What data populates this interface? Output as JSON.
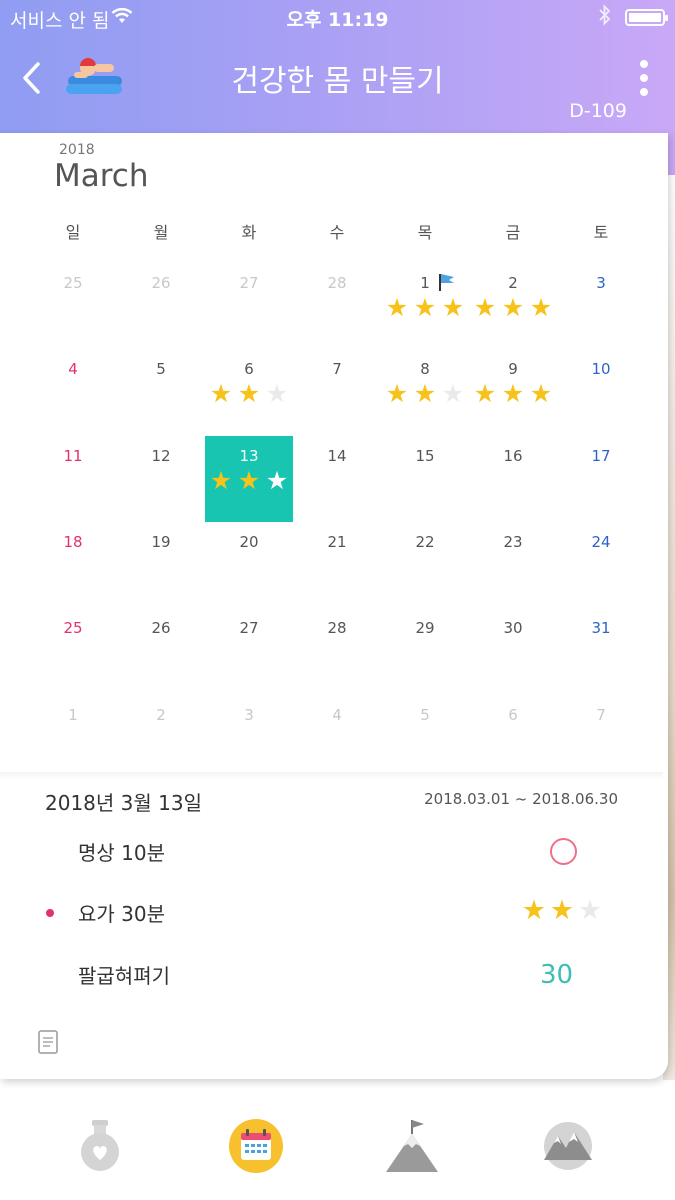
{
  "status": {
    "carrier": "서비스 안 됨",
    "time": "오후 11:19"
  },
  "header": {
    "title": "건강한 몸 만들기",
    "dday": "D-109"
  },
  "calendar": {
    "year": "2018",
    "month": "March",
    "weekdays": [
      "일",
      "월",
      "화",
      "수",
      "목",
      "금",
      "토"
    ],
    "weeks": [
      [
        {
          "d": "25",
          "t": "other"
        },
        {
          "d": "26",
          "t": "other"
        },
        {
          "d": "27",
          "t": "other"
        },
        {
          "d": "28",
          "t": "other"
        },
        {
          "d": "1",
          "t": "",
          "flag": true,
          "stars": [
            1,
            1,
            1
          ]
        },
        {
          "d": "2",
          "t": "",
          "stars": [
            1,
            1,
            1
          ]
        },
        {
          "d": "3",
          "t": "sat"
        }
      ],
      [
        {
          "d": "4",
          "t": "sun"
        },
        {
          "d": "5",
          "t": ""
        },
        {
          "d": "6",
          "t": "",
          "stars": [
            1,
            1,
            0
          ]
        },
        {
          "d": "7",
          "t": ""
        },
        {
          "d": "8",
          "t": "",
          "stars": [
            1,
            1,
            0
          ]
        },
        {
          "d": "9",
          "t": "",
          "stars": [
            1,
            1,
            1
          ]
        },
        {
          "d": "10",
          "t": "sat"
        }
      ],
      [
        {
          "d": "11",
          "t": "sun"
        },
        {
          "d": "12",
          "t": ""
        },
        {
          "d": "13",
          "t": "selected",
          "stars": [
            1,
            1,
            2
          ]
        },
        {
          "d": "14",
          "t": ""
        },
        {
          "d": "15",
          "t": ""
        },
        {
          "d": "16",
          "t": ""
        },
        {
          "d": "17",
          "t": "sat"
        }
      ],
      [
        {
          "d": "18",
          "t": "sun"
        },
        {
          "d": "19",
          "t": ""
        },
        {
          "d": "20",
          "t": ""
        },
        {
          "d": "21",
          "t": ""
        },
        {
          "d": "22",
          "t": ""
        },
        {
          "d": "23",
          "t": ""
        },
        {
          "d": "24",
          "t": "sat"
        }
      ],
      [
        {
          "d": "25",
          "t": "sun"
        },
        {
          "d": "26",
          "t": ""
        },
        {
          "d": "27",
          "t": ""
        },
        {
          "d": "28",
          "t": ""
        },
        {
          "d": "29",
          "t": ""
        },
        {
          "d": "30",
          "t": ""
        },
        {
          "d": "31",
          "t": "sat"
        }
      ],
      [
        {
          "d": "1",
          "t": "other"
        },
        {
          "d": "2",
          "t": "other"
        },
        {
          "d": "3",
          "t": "other"
        },
        {
          "d": "4",
          "t": "other"
        },
        {
          "d": "5",
          "t": "other"
        },
        {
          "d": "6",
          "t": "other"
        },
        {
          "d": "7",
          "t": "other"
        }
      ]
    ]
  },
  "detail": {
    "date": "2018년 3월 13일",
    "range": "2018.03.01 ~ 2018.06.30",
    "tasks": [
      {
        "label": "명상 10분"
      },
      {
        "label": "요가 30분"
      },
      {
        "label": "팔굽혀펴기",
        "count": "30"
      }
    ]
  },
  "icons": {
    "back": "chevron-left-icon",
    "more": "more-vertical-icon",
    "nav": [
      "potion-heart-icon",
      "calendar-icon",
      "mountain-flag-icon",
      "mountain-circle-icon"
    ]
  },
  "colors": {
    "accent": "#18c5b0",
    "sunday": "#e3316e",
    "saturday": "#2e64c8",
    "star": "#f7c21a"
  }
}
